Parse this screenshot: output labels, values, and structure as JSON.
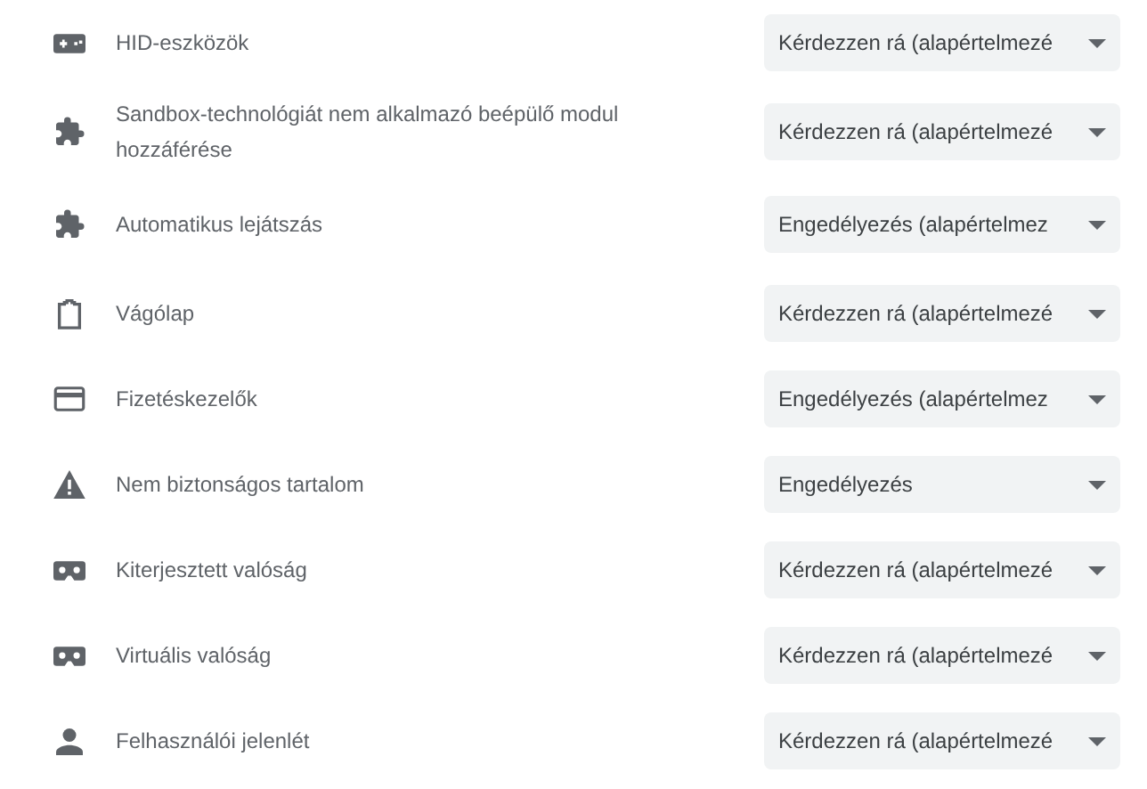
{
  "permissions": [
    {
      "label": "HID-eszközök",
      "value": "Kérdezzen rá (alapértelmezé"
    },
    {
      "label": "Sandbox-technológiát nem alkalmazó beépülő modul hozzáférése",
      "value": "Kérdezzen rá (alapértelmezé"
    },
    {
      "label": "Automatikus lejátszás",
      "value": "Engedélyezés (alapértelmez"
    },
    {
      "label": "Vágólap",
      "value": "Kérdezzen rá (alapértelmezé"
    },
    {
      "label": "Fizetéskezelők",
      "value": "Engedélyezés (alapértelmez"
    },
    {
      "label": "Nem biztonságos tartalom",
      "value": "Engedélyezés"
    },
    {
      "label": "Kiterjesztett valóság",
      "value": "Kérdezzen rá (alapértelmezé"
    },
    {
      "label": "Virtuális valóság",
      "value": "Kérdezzen rá (alapértelmezé"
    },
    {
      "label": "Felhasználói jelenlét",
      "value": "Kérdezzen rá (alapértelmezé"
    }
  ]
}
